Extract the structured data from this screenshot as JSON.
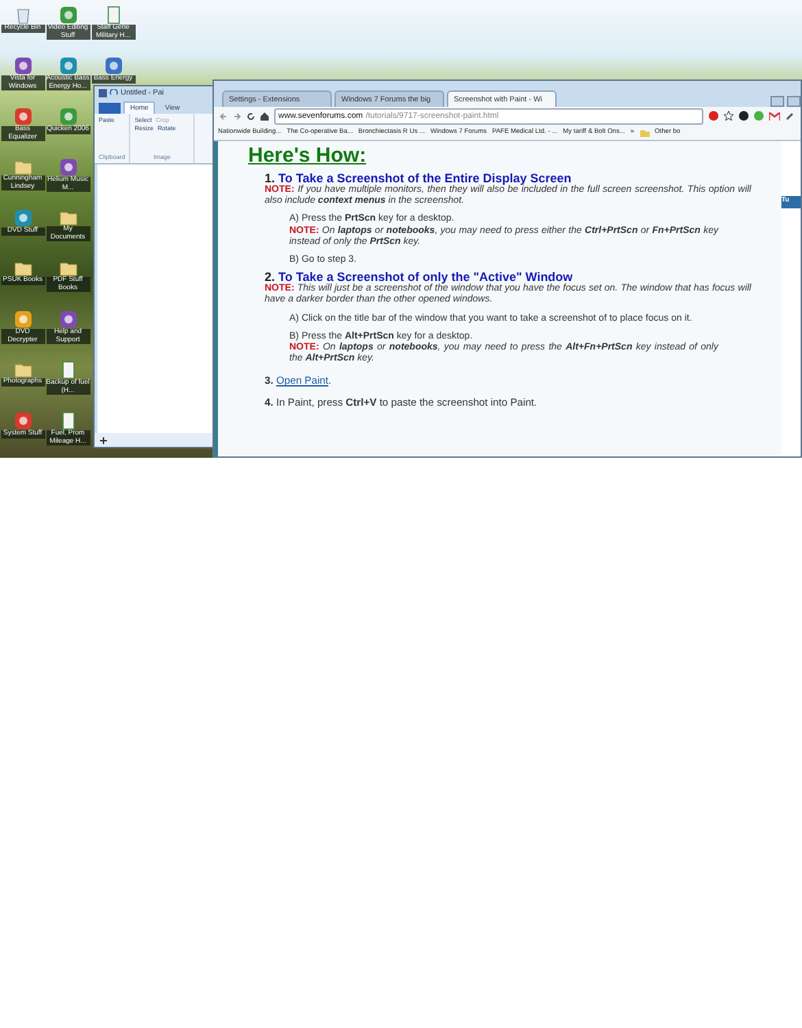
{
  "desktop": {
    "icon_rows": [
      [
        {
          "label": "Recycle Bin",
          "kind": "bin"
        },
        {
          "label": "Video Editing Stuff",
          "kind": "app"
        },
        {
          "label": "Staff Gene Military H...",
          "kind": "sheet"
        }
      ],
      [
        {
          "label": "Vista for Windows",
          "kind": "app"
        },
        {
          "label": "Acoustic Bass Energy Ho...",
          "kind": "app"
        },
        {
          "label": "Bass Energy",
          "kind": "app"
        }
      ],
      [
        {
          "label": "Bass Equalizer",
          "kind": "app"
        },
        {
          "label": "Quicken 2006",
          "kind": "app"
        }
      ],
      [
        {
          "label": "Cunningham Lindsey",
          "kind": "folder"
        },
        {
          "label": "Helium Music M...",
          "kind": "app"
        }
      ],
      [
        {
          "label": "DVD Stuff",
          "kind": "app"
        },
        {
          "label": "My Documents",
          "kind": "folder"
        }
      ],
      [
        {
          "label": "PSUK Books",
          "kind": "folder"
        },
        {
          "label": "PDF Stuff Books",
          "kind": "folder"
        }
      ],
      [
        {
          "label": "DVD Decrypter",
          "kind": "app"
        },
        {
          "label": "Help and Support",
          "kind": "app"
        }
      ],
      [
        {
          "label": "Photographs",
          "kind": "folder"
        },
        {
          "label": "Backup of fuel (H...",
          "kind": "sheet"
        }
      ],
      [
        {
          "label": "System Stuff",
          "kind": "app"
        },
        {
          "label": "Fuel, Prom Mileage H...",
          "kind": "sheet"
        }
      ]
    ]
  },
  "paint": {
    "title": "Untitled - Pai",
    "tabs": [
      {
        "label": "Home",
        "selected": true
      },
      {
        "label": "View",
        "selected": false
      }
    ],
    "groups": [
      {
        "label": "Clipboard",
        "buttons": [
          {
            "label": "Paste",
            "disabled": false
          }
        ]
      },
      {
        "label": "Image",
        "buttons": [
          {
            "label": "Select",
            "disabled": false
          },
          {
            "label": "Crop",
            "disabled": true
          },
          {
            "label": "Resize",
            "disabled": false
          },
          {
            "label": "Rotate",
            "disabled": false
          }
        ]
      }
    ]
  },
  "browser": {
    "tabs": [
      {
        "label": "Settings - Extensions",
        "selected": false
      },
      {
        "label": "Windows 7 Forums the big",
        "selected": false
      },
      {
        "label": "Screenshot with Paint - Wi",
        "selected": true
      }
    ],
    "url_host": "www.sevenforums.com",
    "url_path": "/tutorials/9717-screenshot-paint.html",
    "bookmarks": [
      "Nationwide Building...",
      "The Co-operative Ba...",
      "Bronchiectasis R Us ...",
      "Windows 7 Forums",
      "PAFE Medical Ltd. - ...",
      "My tariff & Bolt Ons..."
    ],
    "more": "»",
    "other_bookmarks": "Other bo",
    "heading": "Here's How:",
    "blocks": [
      {
        "kind": "title",
        "number": "1.",
        "text": "To Take a Screenshot of the Entire Display Screen"
      },
      {
        "kind": "note",
        "label": "NOTE:",
        "text": "If you have multiple monitors, then they will also be included in the full screen screenshot. This option will also include **context menus** in the screenshot."
      },
      {
        "kind": "sub",
        "text": "A) Press the **PrtScn** key for a desktop."
      },
      {
        "kind": "subnote",
        "label": "NOTE:",
        "text": "On **laptops** or **notebooks**, you may need to press either the **Ctrl+PrtScn** or **Fn+PrtScn** key instead of only the **PrtScn** key."
      },
      {
        "kind": "sub",
        "text": "B) Go to step 3."
      },
      {
        "kind": "title",
        "number": "2.",
        "text": "To Take a Screenshot of only the \"Active\" Window"
      },
      {
        "kind": "note",
        "label": "NOTE:",
        "text": "This will just be a screenshot of the window that you have the focus set on. The window that has focus will have a darker border than the other opened windows."
      },
      {
        "kind": "sub",
        "text": "A) Click on the title bar of the window that you want to take a screenshot of to place focus on it."
      },
      {
        "kind": "sub",
        "text": "B) Press the **Alt+PrtScn** key for a desktop."
      },
      {
        "kind": "subnote",
        "label": "NOTE:",
        "text": "On **laptops** or **notebooks**, you may need to press the **Alt+Fn+PrtScn** key instead of only the **Alt+PrtScn** key."
      },
      {
        "kind": "link",
        "number": "3.",
        "text": "Open Paint",
        "after": "."
      },
      {
        "kind": "plain",
        "number": "4.",
        "text": "In Paint, press **Ctrl+V** to paste the screenshot into Paint."
      }
    ],
    "sidebar_title": "Tu"
  }
}
